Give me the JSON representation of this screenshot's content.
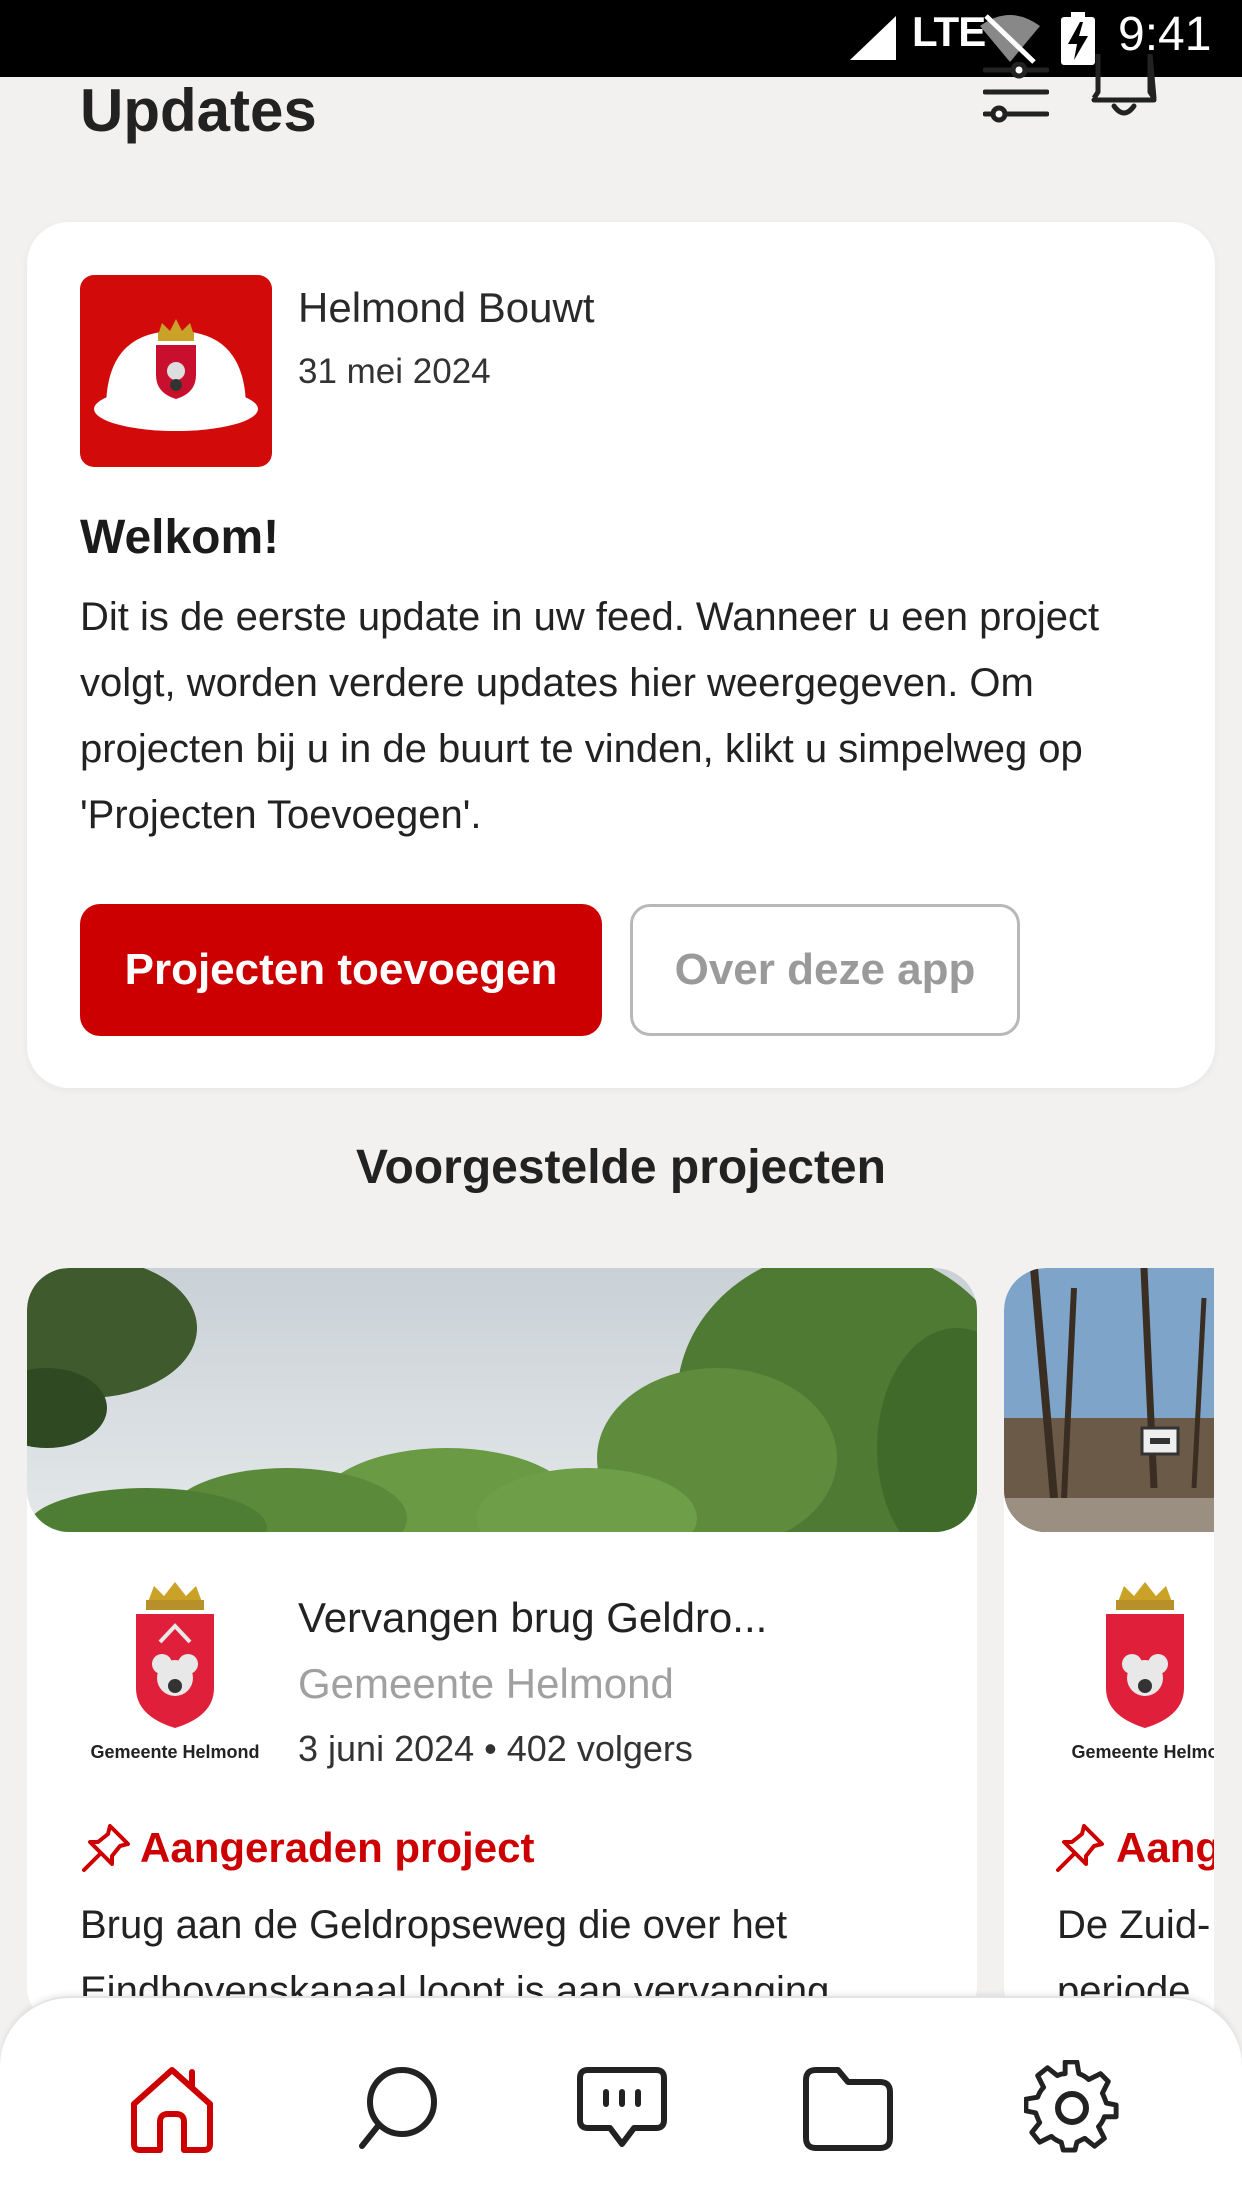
{
  "status_bar": {
    "network": "LTE",
    "time": "9:41"
  },
  "header": {
    "title": "Updates",
    "filter_icon": "sliders-icon",
    "notification_icon": "bell-icon"
  },
  "welcome_card": {
    "org_name": "Helmond Bouwt",
    "date": "31 mei 2024",
    "title": "Welkom!",
    "body": "Dit is de eerste update in uw feed. Wanneer u een project volgt, worden verdere updates hier weergegeven. Om projecten bij u in de buurt te vinden, klikt u simpelweg op 'Projecten Toevoegen'.",
    "primary_button": "Projecten toevoegen",
    "secondary_button": "Over deze app"
  },
  "suggested": {
    "title": "Voorgestelde projecten",
    "projects": [
      {
        "logo_caption": "Gemeente Helmond",
        "title": "Vervangen brug Geldro...",
        "organization": "Gemeente Helmond",
        "meta": "3 juni 2024 • 402 volgers",
        "tag": "Aangeraden project",
        "description_line1": "Brug aan de Geldropseweg die over het",
        "description_line2": "Eindhovenskanaal loopt is aan vervanging"
      },
      {
        "logo_caption": "Gemeente Helmo",
        "tag": "Aang",
        "description_line1": "De Zuid-",
        "description_line2": "periode"
      }
    ]
  },
  "bottom_nav": {
    "items": [
      {
        "icon": "home-icon",
        "active": true
      },
      {
        "icon": "search-icon",
        "active": false
      },
      {
        "icon": "chat-icon",
        "active": false
      },
      {
        "icon": "folder-icon",
        "active": false
      },
      {
        "icon": "settings-icon",
        "active": false
      }
    ]
  },
  "colors": {
    "brand_red": "#cc0000",
    "background": "#f2f1f0",
    "card": "#ffffff",
    "muted_text": "#a0a0a0"
  }
}
